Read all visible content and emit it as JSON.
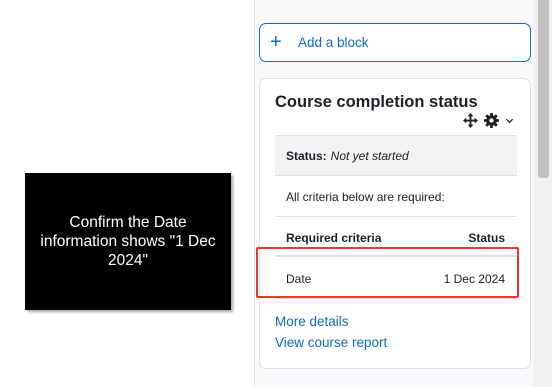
{
  "add_block": {
    "icon": "plus-icon",
    "label": "Add a block"
  },
  "completion_block": {
    "title": "Course completion status",
    "controls": {
      "move_icon": "move-icon",
      "settings_icon": "gear-icon",
      "menu_icon": "chevron-down-icon"
    },
    "status_label": "Status:",
    "status_value": "Not yet started",
    "criteria_note": "All criteria below are required:",
    "table": {
      "headers": [
        "Required criteria",
        "Status"
      ],
      "rows": [
        {
          "criteria": "Date",
          "status": "1 Dec 2024"
        }
      ]
    },
    "links": {
      "more_details": "More details",
      "view_report": "View course report"
    }
  },
  "tutorial_tip": {
    "text": "Confirm the Date information shows \"1 Dec 2024\""
  },
  "colors": {
    "link": "#0f6cbf",
    "highlight": "#e53935",
    "tooltip_bg": "#000000"
  }
}
